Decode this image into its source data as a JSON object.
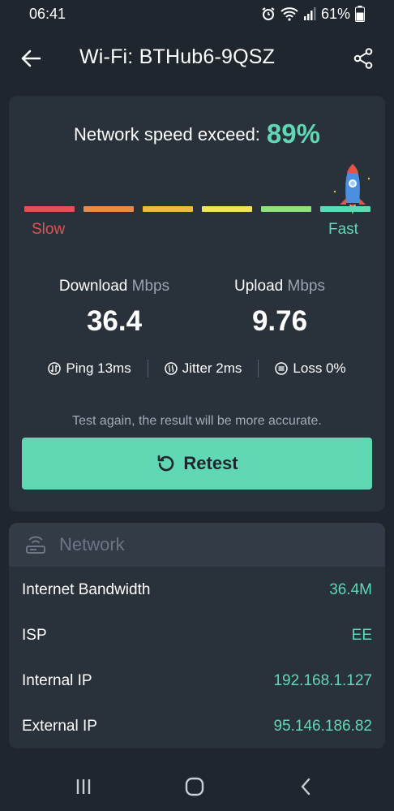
{
  "status_bar": {
    "time": "06:41",
    "battery": "61%"
  },
  "app_bar": {
    "title": "Wi-Fi: BTHub6-9QSZ"
  },
  "speed": {
    "exceed_label": "Network speed exceed:",
    "exceed_value": "89%",
    "scale_slow": "Slow",
    "scale_fast": "Fast",
    "meter_colors": [
      "#e05353",
      "#e88a4a",
      "#efb845",
      "#f0e35a",
      "#8ee27a",
      "#5fd8b3"
    ],
    "download_label": "Download",
    "upload_label": "Upload",
    "unit": "Mbps",
    "download_value": "36.4",
    "upload_value": "9.76",
    "ping": "Ping 13ms",
    "jitter": "Jitter 2ms",
    "loss": "Loss 0%",
    "hint": "Test again, the result will be more accurate.",
    "retest_label": "Retest"
  },
  "network": {
    "title": "Network",
    "rows": [
      {
        "key": "Internet Bandwidth",
        "value": "36.4M"
      },
      {
        "key": "ISP",
        "value": "EE"
      },
      {
        "key": "Internal IP",
        "value": "192.168.1.127"
      },
      {
        "key": "External IP",
        "value": "95.146.186.82"
      }
    ]
  },
  "colors": {
    "accent": "#5fd8b3",
    "background": "#1f262e",
    "card": "#29313a",
    "slow": "#e05353"
  }
}
